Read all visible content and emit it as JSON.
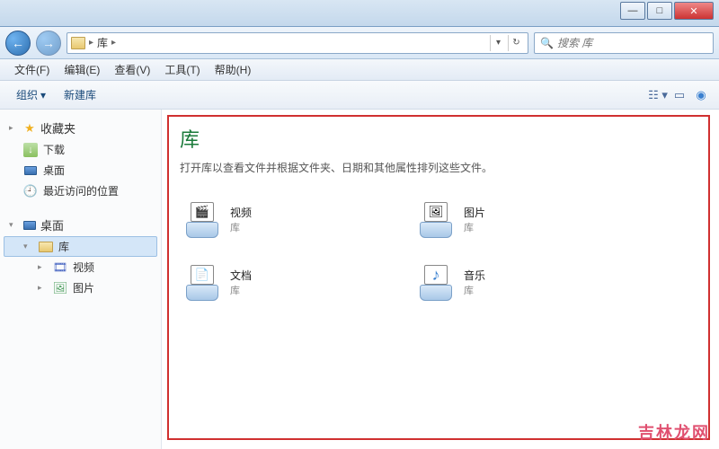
{
  "window_controls": {
    "min": "—",
    "max": "□",
    "close": "✕"
  },
  "nav": {
    "back": "←",
    "forward": "→",
    "refresh": "↻",
    "dropdown": "▾"
  },
  "address": {
    "location": "库",
    "sep": "▸"
  },
  "search": {
    "placeholder": "搜索 库"
  },
  "menubar": {
    "file": "文件(F)",
    "edit": "编辑(E)",
    "view": "查看(V)",
    "tools": "工具(T)",
    "help": "帮助(H)"
  },
  "toolbar": {
    "organize": "组织",
    "new_library": "新建库"
  },
  "sidebar": {
    "favorites": {
      "label": "收藏夹"
    },
    "downloads": {
      "label": "下载"
    },
    "desktop_fav": {
      "label": "桌面"
    },
    "recent": {
      "label": "最近访问的位置"
    },
    "desktop": {
      "label": "桌面"
    },
    "library": {
      "label": "库"
    },
    "videos": {
      "label": "视频"
    },
    "pictures": {
      "label": "图片"
    }
  },
  "content": {
    "title": "库",
    "description": "打开库以查看文件并根据文件夹、日期和其他属性排列这些文件。",
    "sub": "库",
    "libraries": [
      {
        "name": "视频",
        "glyph": "🎬"
      },
      {
        "name": "图片",
        "glyph": "🖼"
      },
      {
        "name": "文档",
        "glyph": "📄"
      },
      {
        "name": "音乐",
        "glyph": "♪"
      }
    ]
  },
  "watermark": "吉林龙网"
}
